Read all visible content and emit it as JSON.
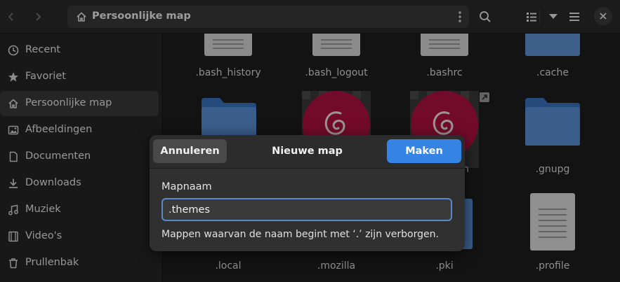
{
  "header": {
    "path_label": "Persoonlijke map"
  },
  "sidebar": {
    "items": [
      {
        "label": "Recent",
        "icon": "clock-icon"
      },
      {
        "label": "Favoriet",
        "icon": "star-icon"
      },
      {
        "label": "Persoonlijke map",
        "icon": "home-icon",
        "active": true
      },
      {
        "label": "Afbeeldingen",
        "icon": "image-icon"
      },
      {
        "label": "Documenten",
        "icon": "document-icon"
      },
      {
        "label": "Downloads",
        "icon": "download-icon"
      },
      {
        "label": "Muziek",
        "icon": "music-icon"
      },
      {
        "label": "Video's",
        "icon": "film-icon"
      },
      {
        "label": "Prullenbak",
        "icon": "trash-icon"
      }
    ]
  },
  "files": {
    "row1": [
      ".bash_history",
      ".bash_logout",
      ".bashrc",
      ".cache"
    ],
    "row2_partial": [
      "n"
    ],
    "row2_visible": [
      ".gnupg"
    ],
    "row3": [
      ".local",
      ".mozilla",
      ".pki",
      ".profile"
    ]
  },
  "dialog": {
    "cancel_label": "Annuleren",
    "title": "Nieuwe map",
    "make_label": "Maken",
    "field_label": "Mapnaam",
    "field_value": ".themes",
    "hint": "Mappen waarvan de naam begint met ‘.’ zijn verborgen."
  },
  "colors": {
    "accent": "#3584e4",
    "folder": "#4a86d2",
    "debian_red": "#b0123f"
  }
}
